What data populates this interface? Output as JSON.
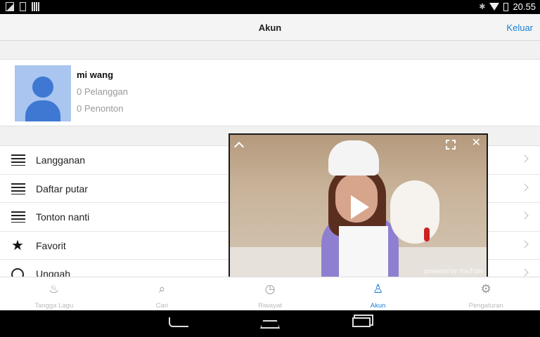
{
  "status_bar": {
    "time": "20.55",
    "icons": [
      "image-icon",
      "phone-icon",
      "barcode-icon",
      "bluetooth-icon",
      "wifi-icon",
      "battery-icon"
    ]
  },
  "app_bar": {
    "title": "Akun",
    "action": "Keluar"
  },
  "profile": {
    "name": "mi wang",
    "subscribers": "0 Pelanggan",
    "views": "0 Penonton"
  },
  "menu": {
    "items": [
      {
        "label": "Langganan",
        "icon": "subscriptions-icon"
      },
      {
        "label": "Daftar putar",
        "icon": "playlist-icon"
      },
      {
        "label": "Tonton nanti",
        "icon": "watch-later-icon"
      },
      {
        "label": "Favorit",
        "icon": "star-icon"
      },
      {
        "label": "Unggah",
        "icon": "upload-icon"
      }
    ]
  },
  "video": {
    "watermark": "powered by YouTube"
  },
  "bottom_nav": {
    "items": [
      {
        "label": "Tangga Lagu",
        "icon": "flame-icon"
      },
      {
        "label": "Cari",
        "icon": "search-icon"
      },
      {
        "label": "Riwayat",
        "icon": "history-icon"
      },
      {
        "label": "Akun",
        "icon": "account-icon",
        "active": true
      },
      {
        "label": "Pengaturan",
        "icon": "settings-icon"
      }
    ]
  },
  "colors": {
    "accent": "#1a7fd6",
    "avatar_bg": "#a9c5f0",
    "avatar_fg": "#3e78d3"
  }
}
